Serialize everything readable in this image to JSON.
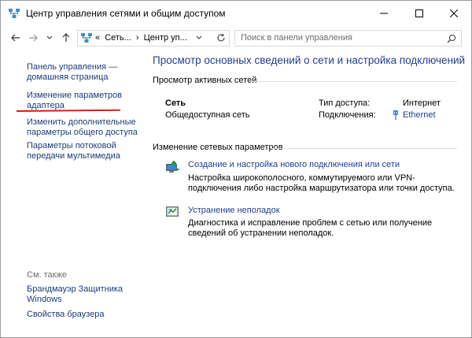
{
  "window": {
    "title": "Центр управления сетями и общим доступом"
  },
  "address": {
    "chevrons": "«",
    "crumbs": [
      "Сеть...",
      "›",
      "Центр уп..."
    ]
  },
  "search": {
    "placeholder": "Поиск в панели управления"
  },
  "sidebar": {
    "items": [
      {
        "label": "Панель управления — домашняя страница"
      },
      {
        "label": "Изменение параметров адаптера"
      },
      {
        "label": "Изменить дополнительные параметры общего доступа"
      },
      {
        "label": "Параметры потоковой передачи мультимедиа"
      }
    ],
    "see_also": "См. также",
    "see_also_items": [
      {
        "label": "Брандмауэр Защитника Windows"
      },
      {
        "label": "Свойства браузера"
      }
    ]
  },
  "main": {
    "title": "Просмотр основных сведений о сети и настройка подключений",
    "active_networks_label": "Просмотр активных сетей",
    "network": {
      "name": "Сеть",
      "type": "Общедоступная сеть",
      "access_type_label": "Тип доступа:",
      "access_type_value": "Интернет",
      "connections_label": "Подключения:",
      "connections_value": "Ethernet"
    },
    "change_settings_label": "Изменение сетевых параметров",
    "tasks": [
      {
        "icon": "network-setup-icon",
        "link": "Создание и настройка нового подключения или сети",
        "desc": "Настройка широкополосного, коммутируемого или VPN-подключения либо настройка маршрутизатора или точки доступа."
      },
      {
        "icon": "troubleshoot-icon",
        "link": "Устранение неполадок",
        "desc": "Диагностика и исправление проблем с сетью или получение сведений об устранении неполадок."
      }
    ]
  },
  "colors": {
    "link": "#1f3e94",
    "sidebar_link": "#1a3c78",
    "highlight_underline": "#e0161b"
  }
}
